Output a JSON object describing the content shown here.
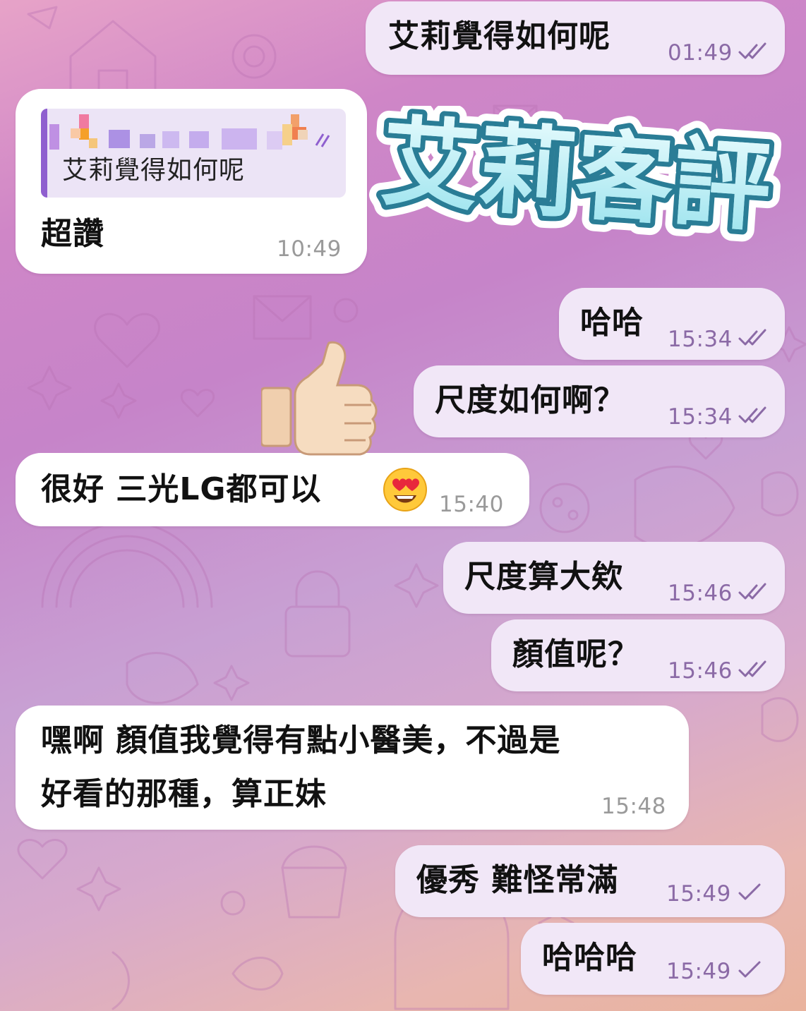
{
  "overlay": {
    "title": "艾莉客評"
  },
  "messages": [
    {
      "id": "m1",
      "direction": "outgoing",
      "text": "艾莉覺得如何呢",
      "time": "01:49",
      "status": "read"
    },
    {
      "id": "m2",
      "direction": "incoming",
      "reply_to": {
        "text": "艾莉覺得如何呢"
      },
      "text": "超讚",
      "time": "10:49"
    },
    {
      "id": "m3",
      "direction": "outgoing",
      "text": "哈哈",
      "time": "15:34",
      "status": "read"
    },
    {
      "id": "m4",
      "direction": "outgoing",
      "text": "尺度如何啊？",
      "time": "15:34",
      "status": "read"
    },
    {
      "id": "m5",
      "direction": "incoming",
      "text": "很好 三光LG都可以",
      "time": "15:40"
    },
    {
      "id": "m6",
      "direction": "outgoing",
      "text": "尺度算大欸",
      "time": "15:46",
      "status": "read"
    },
    {
      "id": "m7",
      "direction": "outgoing",
      "text": "顏值呢？",
      "time": "15:46",
      "status": "read"
    },
    {
      "id": "m8",
      "direction": "incoming",
      "lines": [
        "嘿啊 顏值我覺得有點小醫美，不過是",
        "好看的那種，算正妹"
      ],
      "time": "15:48"
    },
    {
      "id": "m9",
      "direction": "outgoing",
      "text": "優秀 難怪常滿",
      "time": "15:49",
      "status": "sent"
    },
    {
      "id": "m10",
      "direction": "outgoing",
      "text": "哈哈哈",
      "time": "15:49",
      "status": "sent"
    }
  ],
  "icons": {
    "read_status": "double-check-icon",
    "sent_status": "single-check-icon",
    "thumbs_up": "thumbs-up-emoji",
    "heart_eyes": "heart-eyes-emoji"
  },
  "colors": {
    "outgoing_bubble": "#f1e7f7",
    "incoming_bubble": "#ffffff",
    "outgoing_time": "#8b6aa6",
    "incoming_time": "#9a9a9a",
    "reply_accent": "#8f5fcf",
    "title_fill": "#bff0f6",
    "title_outline": "#2a7d96"
  }
}
